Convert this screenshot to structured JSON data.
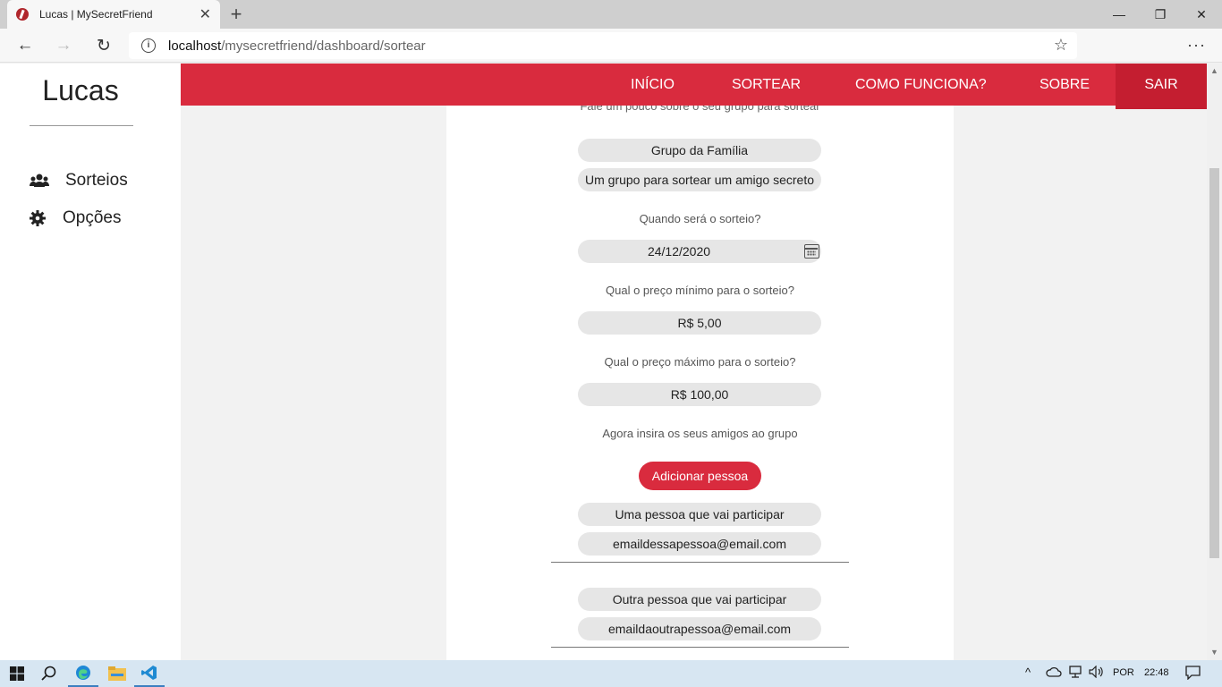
{
  "browser": {
    "tab_title": "Lucas | MySecretFriend",
    "url_host": "localhost",
    "url_path": "/mysecretfriend/dashboard/sortear"
  },
  "sidebar": {
    "user_name": "Lucas",
    "items": [
      {
        "label": "Sorteios",
        "icon": "users-icon"
      },
      {
        "label": "Opções",
        "icon": "gear-icon"
      }
    ]
  },
  "topnav": {
    "links": [
      "INÍCIO",
      "SORTEAR",
      "COMO FUNCIONA?",
      "SOBRE"
    ],
    "logout": "SAIR"
  },
  "form": {
    "intro_cut": "Fale um pouco sobre o seu grupo para sortear",
    "group_name": "Grupo da Família",
    "group_description": "Um grupo para sortear um amigo secreto",
    "date_label": "Quando será o sorteio?",
    "date_value": "24/12/2020",
    "min_price_label": "Qual o preço mínimo para o sorteio?",
    "min_price_value": "R$ 5,00",
    "max_price_label": "Qual o preço máximo para o sorteio?",
    "max_price_value": "R$ 100,00",
    "friends_label": "Agora insira os seus amigos ao grupo",
    "add_button": "Adicionar pessoa",
    "people": [
      {
        "name": "Uma pessoa que vai participar",
        "email": "emaildessapessoa@email.com"
      },
      {
        "name": "Outra pessoa que vai participar",
        "email": "emaildaoutrapessoa@email.com"
      }
    ]
  },
  "taskbar": {
    "language": "POR",
    "time": "22:48"
  },
  "colors": {
    "accent": "#d92b3e",
    "accent_dark": "#c41e30"
  }
}
